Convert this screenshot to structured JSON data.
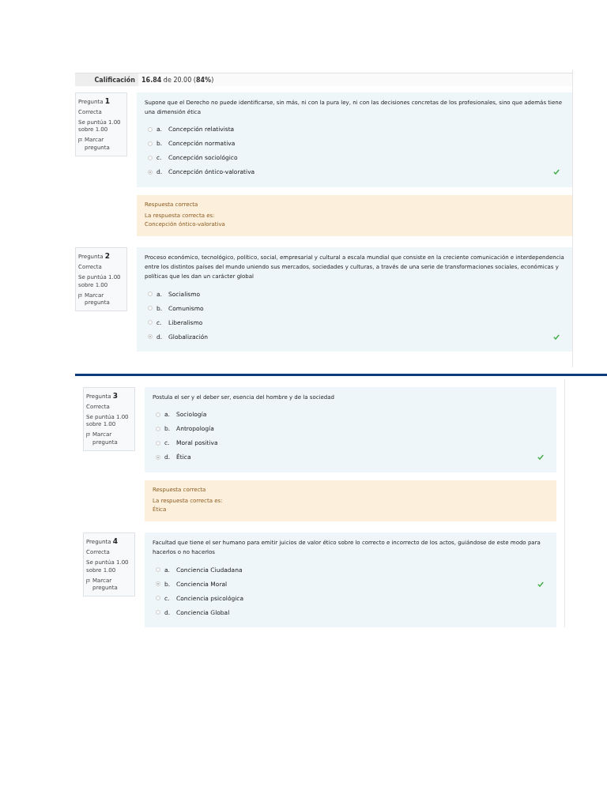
{
  "summary": {
    "label": "Calificación",
    "value": "**16.84** de 20.00 (**84%**)"
  },
  "panels": [
    {
      "questions": [
        {
          "heading": "Pregunta",
          "number": "1",
          "status": "Correcta",
          "score": "Se puntúa 1.00 sobre 1.00",
          "flag": "Marcar pregunta",
          "text": "Supone que el Derecho no puede identificarse, sin más, ni con la pura ley, ni con las decisiones concretas de los profesionales, sino que además tiene una dimensión ética",
          "options": [
            {
              "letter": "a.",
              "text": "Concepción relativista",
              "selected": false,
              "correct_mark": false
            },
            {
              "letter": "b.",
              "text": "Concepción normativa",
              "selected": false,
              "correct_mark": false
            },
            {
              "letter": "c.",
              "text": "Concepción sociológico",
              "selected": false,
              "correct_mark": false
            },
            {
              "letter": "d.",
              "text": "Concepción óntico-valorativa",
              "selected": true,
              "correct_mark": true
            }
          ],
          "feedback": {
            "title": "Respuesta correcta",
            "intro": "La respuesta correcta es:",
            "answer": "Concepción óntico-valorativa"
          }
        },
        {
          "heading": "Pregunta",
          "number": "2",
          "status": "Correcta",
          "score": "Se puntúa 1.00 sobre 1.00",
          "flag": "Marcar pregunta",
          "text": "Proceso económico, tecnológico, político, social, empresarial y cultural a escala mundial que consiste en la creciente comunicación e interdependencia entre los distintos países del mundo uniendo sus mercados, sociedades y culturas, a través de una serie de transformaciones sociales, económicas y políticas que les dan un carácter global",
          "options": [
            {
              "letter": "a.",
              "text": "Socialismo",
              "selected": false,
              "correct_mark": false
            },
            {
              "letter": "b.",
              "text": "Comunismo",
              "selected": false,
              "correct_mark": false
            },
            {
              "letter": "c.",
              "text": "Liberalismo",
              "selected": false,
              "correct_mark": false
            },
            {
              "letter": "d.",
              "text": "Globalización",
              "selected": true,
              "correct_mark": true
            }
          ]
        }
      ]
    },
    {
      "questions": [
        {
          "heading": "Pregunta",
          "number": "3",
          "status": "Correcta",
          "score": "Se puntúa 1.00 sobre 1.00",
          "flag": "Marcar pregunta",
          "text": "Postula el ser y el deber ser, esencia del hombre y de la sociedad",
          "options": [
            {
              "letter": "a.",
              "text": "Sociología",
              "selected": false,
              "correct_mark": false
            },
            {
              "letter": "b.",
              "text": "Antropología",
              "selected": false,
              "correct_mark": false
            },
            {
              "letter": "c.",
              "text": "Moral positiva",
              "selected": false,
              "correct_mark": false
            },
            {
              "letter": "d.",
              "text": "Ética",
              "selected": true,
              "correct_mark": true
            }
          ],
          "feedback": {
            "title": "Respuesta correcta",
            "intro": "La respuesta correcta es:",
            "answer": "Ética"
          }
        },
        {
          "heading": "Pregunta",
          "number": "4",
          "status": "Correcta",
          "score": "Se puntúa 1.00 sobre 1.00",
          "flag": "Marcar pregunta",
          "text": "Facultad que tiene el ser humano para emitir juicios de valor ético sobre lo correcto e incorrecto de los actos, guiándose de este modo para hacerlos o no hacerlos",
          "options": [
            {
              "letter": "a.",
              "text": "Conciencia Ciudadana",
              "selected": false,
              "correct_mark": false
            },
            {
              "letter": "b.",
              "text": "Conciencia Moral",
              "selected": true,
              "correct_mark": true
            },
            {
              "letter": "c.",
              "text": "Conciencia psicológica",
              "selected": false,
              "correct_mark": false
            },
            {
              "letter": "d.",
              "text": "Conciencia Global",
              "selected": false,
              "correct_mark": false
            }
          ]
        }
      ]
    }
  ]
}
